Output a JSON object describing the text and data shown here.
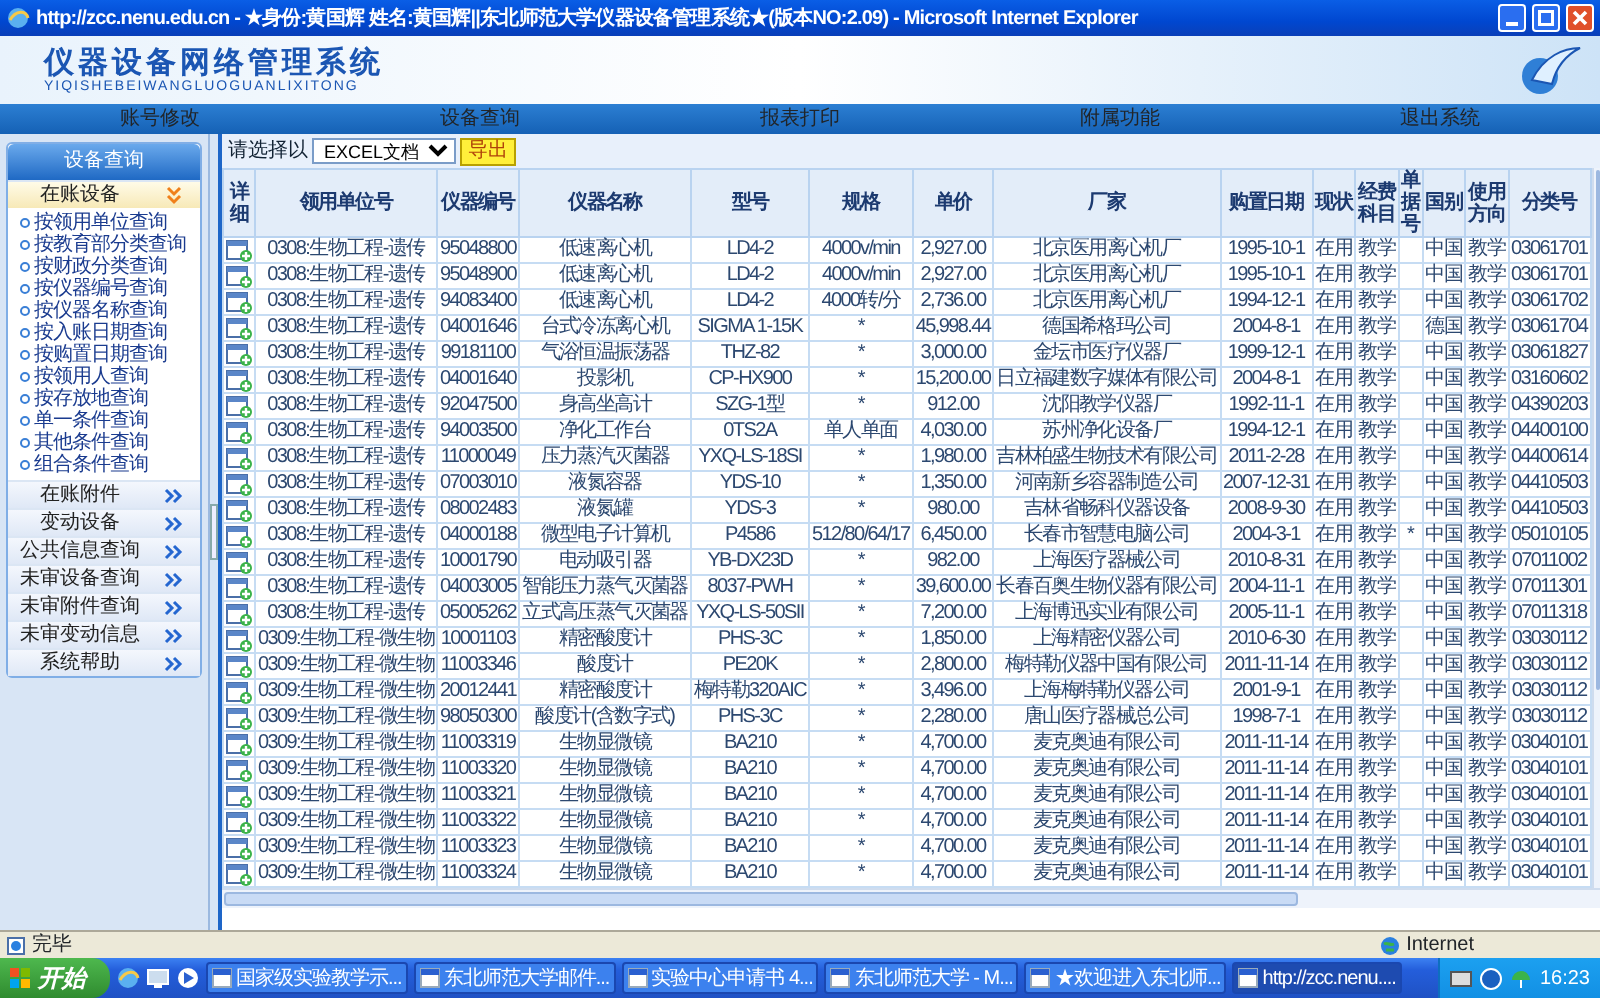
{
  "window": {
    "title": "http://zcc.nenu.edu.cn - ★身份:黄国辉 姓名:黄国辉||东北师范大学仪器设备管理系统★(版本NO:2.09) - Microsoft Internet Explorer"
  },
  "banner": {
    "title": "仪器设备网络管理系统",
    "subtitle": "YIQISHEBEIWANGLUOGUANLIXITONG"
  },
  "menu": [
    {
      "label": "账号修改"
    },
    {
      "label": "设备查询"
    },
    {
      "label": "报表打印"
    },
    {
      "label": "附属功能"
    },
    {
      "label": "退出系统"
    }
  ],
  "sidebar": {
    "title": "设备查询",
    "sections": [
      {
        "label": "在账设备",
        "expanded": true,
        "items": [
          "按领用单位查询",
          "按教育部分类查询",
          "按财政分类查询",
          "按仪器编号查询",
          "按仪器名称查询",
          "按入账日期查询",
          "按购置日期查询",
          "按领用人查询",
          "按存放地查询",
          "单一条件查询",
          "其他条件查询",
          "组合条件查询"
        ]
      },
      {
        "label": "在账附件",
        "expanded": false
      },
      {
        "label": "变动设备",
        "expanded": false
      },
      {
        "label": "公共信息查询",
        "expanded": false
      },
      {
        "label": "未审设备查询",
        "expanded": false
      },
      {
        "label": "未审附件查询",
        "expanded": false
      },
      {
        "label": "未审变动信息",
        "expanded": false
      },
      {
        "label": "系统帮助",
        "expanded": false
      }
    ]
  },
  "toolbar": {
    "label": "请选择以",
    "format": "EXCEL文档",
    "button": "导出"
  },
  "table": {
    "columns": [
      "详细",
      "领用单位号",
      "仪器编号",
      "仪器名称",
      "型号",
      "规格",
      "单价",
      "厂家",
      "购置日期",
      "现状",
      "经费科目",
      "单据号",
      "国别",
      "使用方向",
      "分类号"
    ],
    "rows": [
      {
        "unit": "0308:生物工程-遗传",
        "code": "95048800",
        "name": "低速离心机",
        "model": "LD4-2",
        "spec": "4000v/min",
        "price": "2,927.00",
        "maker": "北京医用离心机厂",
        "date": "1995-10-1",
        "status": "在用",
        "fund": "教学",
        "country": "中国",
        "usage": "教学",
        "class": "03061701"
      },
      {
        "unit": "0308:生物工程-遗传",
        "code": "95048900",
        "name": "低速离心机",
        "model": "LD4-2",
        "spec": "4000v/min",
        "price": "2,927.00",
        "maker": "北京医用离心机厂",
        "date": "1995-10-1",
        "status": "在用",
        "fund": "教学",
        "country": "中国",
        "usage": "教学",
        "class": "03061701"
      },
      {
        "unit": "0308:生物工程-遗传",
        "code": "94083400",
        "name": "低速离心机",
        "model": "LD4-2",
        "spec": "4000转/分",
        "price": "2,736.00",
        "maker": "北京医用离心机厂",
        "date": "1994-12-1",
        "status": "在用",
        "fund": "教学",
        "country": "中国",
        "usage": "教学",
        "class": "03061702"
      },
      {
        "unit": "0308:生物工程-遗传",
        "code": "04001646",
        "name": "台式冷冻离心机",
        "model": "SIGMA 1-15K",
        "spec": "*",
        "price": "45,998.44",
        "maker": "德国希格玛公司",
        "date": "2004-8-1",
        "status": "在用",
        "fund": "教学",
        "country": "德国",
        "usage": "教学",
        "class": "03061704"
      },
      {
        "unit": "0308:生物工程-遗传",
        "code": "99181100",
        "name": "气浴恒温振荡器",
        "model": "THZ-82",
        "spec": "*",
        "price": "3,000.00",
        "maker": "金坛市医疗仪器厂",
        "date": "1999-12-1",
        "status": "在用",
        "fund": "教学",
        "country": "中国",
        "usage": "教学",
        "class": "03061827"
      },
      {
        "unit": "0308:生物工程-遗传",
        "code": "04001640",
        "name": "投影机",
        "model": "CP-HX900",
        "spec": "*",
        "price": "15,200.00",
        "maker": "日立福建数字媒体有限公司",
        "date": "2004-8-1",
        "status": "在用",
        "fund": "教学",
        "country": "中国",
        "usage": "教学",
        "class": "03160602"
      },
      {
        "unit": "0308:生物工程-遗传",
        "code": "92047500",
        "name": "身高坐高计",
        "model": "SZG-1型",
        "spec": "*",
        "price": "912.00",
        "maker": "沈阳教学仪器厂",
        "date": "1992-11-1",
        "status": "在用",
        "fund": "教学",
        "country": "中国",
        "usage": "教学",
        "class": "04390203"
      },
      {
        "unit": "0308:生物工程-遗传",
        "code": "94003500",
        "name": "净化工作台",
        "model": "0TS2A",
        "spec": "单人单面",
        "price": "4,030.00",
        "maker": "苏州净化设备厂",
        "date": "1994-12-1",
        "status": "在用",
        "fund": "教学",
        "country": "中国",
        "usage": "教学",
        "class": "04400100"
      },
      {
        "unit": "0308:生物工程-遗传",
        "code": "11000049",
        "name": "压力蒸汽灭菌器",
        "model": "YXQ-LS-18SI",
        "spec": "*",
        "price": "1,980.00",
        "maker": "吉林柏盛生物技术有限公司",
        "date": "2011-2-28",
        "status": "在用",
        "fund": "教学",
        "country": "中国",
        "usage": "教学",
        "class": "04400614"
      },
      {
        "unit": "0308:生物工程-遗传",
        "code": "07003010",
        "name": "液氮容器",
        "model": "YDS-10",
        "spec": "*",
        "price": "1,350.00",
        "maker": "河南新乡容器制造公司",
        "date": "2007-12-31",
        "status": "在用",
        "fund": "教学",
        "country": "中国",
        "usage": "教学",
        "class": "04410503"
      },
      {
        "unit": "0308:生物工程-遗传",
        "code": "08002483",
        "name": "液氮罐",
        "model": "YDS-3",
        "spec": "*",
        "price": "980.00",
        "maker": "吉林省畅科仪器设备",
        "date": "2008-9-30",
        "status": "在用",
        "fund": "教学",
        "country": "中国",
        "usage": "教学",
        "class": "04410503"
      },
      {
        "unit": "0308:生物工程-遗传",
        "code": "04000188",
        "name": "微型电子计算机",
        "model": "P4586",
        "spec": "512/80/64/17",
        "price": "6,450.00",
        "maker": "长春市智慧电脑公司",
        "date": "2004-3-1",
        "status": "在用",
        "fund": "教学",
        "doc": "*",
        "country": "中国",
        "usage": "教学",
        "class": "05010105"
      },
      {
        "unit": "0308:生物工程-遗传",
        "code": "10001790",
        "name": "电动吸引器",
        "model": "YB-DX23D",
        "spec": "*",
        "price": "982.00",
        "maker": "上海医疗器械公司",
        "date": "2010-8-31",
        "status": "在用",
        "fund": "教学",
        "country": "中国",
        "usage": "教学",
        "class": "07011002"
      },
      {
        "unit": "0308:生物工程-遗传",
        "code": "04003005",
        "name": "智能压力蒸气灭菌器",
        "model": "8037-PWH",
        "spec": "*",
        "price": "39,600.00",
        "maker": "长春百奥生物仪器有限公司",
        "date": "2004-11-1",
        "status": "在用",
        "fund": "教学",
        "country": "中国",
        "usage": "教学",
        "class": "07011301"
      },
      {
        "unit": "0308:生物工程-遗传",
        "code": "05005262",
        "name": "立式高压蒸气灭菌器",
        "model": "YXQ-LS-50SII",
        "spec": "*",
        "price": "7,200.00",
        "maker": "上海博迅实业有限公司",
        "date": "2005-11-1",
        "status": "在用",
        "fund": "教学",
        "country": "中国",
        "usage": "教学",
        "class": "07011318"
      },
      {
        "unit": "0309:生物工程-微生物",
        "code": "10001103",
        "name": "精密酸度计",
        "model": "PHS-3C",
        "spec": "*",
        "price": "1,850.00",
        "maker": "上海精密仪器公司",
        "date": "2010-6-30",
        "status": "在用",
        "fund": "教学",
        "country": "中国",
        "usage": "教学",
        "class": "03030112"
      },
      {
        "unit": "0309:生物工程-微生物",
        "code": "11003346",
        "name": "酸度计",
        "model": "PE20K",
        "spec": "*",
        "price": "2,800.00",
        "maker": "梅特勒仪器中国有限公司",
        "date": "2011-11-14",
        "status": "在用",
        "fund": "教学",
        "country": "中国",
        "usage": "教学",
        "class": "03030112"
      },
      {
        "unit": "0309:生物工程-微生物",
        "code": "20012441",
        "name": "精密酸度计",
        "model": "梅特勒320AIC",
        "spec": "*",
        "price": "3,496.00",
        "maker": "上海梅特勒仪器公司",
        "date": "2001-9-1",
        "status": "在用",
        "fund": "教学",
        "country": "中国",
        "usage": "教学",
        "class": "03030112"
      },
      {
        "unit": "0309:生物工程-微生物",
        "code": "98050300",
        "name": "酸度计(含数字式)",
        "model": "PHS-3C",
        "spec": "*",
        "price": "2,280.00",
        "maker": "唐山医疗器械总公司",
        "date": "1998-7-1",
        "status": "在用",
        "fund": "教学",
        "country": "中国",
        "usage": "教学",
        "class": "03030112"
      },
      {
        "unit": "0309:生物工程-微生物",
        "code": "11003319",
        "name": "生物显微镜",
        "model": "BA210",
        "spec": "*",
        "price": "4,700.00",
        "maker": "麦克奥迪有限公司",
        "date": "2011-11-14",
        "status": "在用",
        "fund": "教学",
        "country": "中国",
        "usage": "教学",
        "class": "03040101"
      },
      {
        "unit": "0309:生物工程-微生物",
        "code": "11003320",
        "name": "生物显微镜",
        "model": "BA210",
        "spec": "*",
        "price": "4,700.00",
        "maker": "麦克奥迪有限公司",
        "date": "2011-11-14",
        "status": "在用",
        "fund": "教学",
        "country": "中国",
        "usage": "教学",
        "class": "03040101"
      },
      {
        "unit": "0309:生物工程-微生物",
        "code": "11003321",
        "name": "生物显微镜",
        "model": "BA210",
        "spec": "*",
        "price": "4,700.00",
        "maker": "麦克奥迪有限公司",
        "date": "2011-11-14",
        "status": "在用",
        "fund": "教学",
        "country": "中国",
        "usage": "教学",
        "class": "03040101"
      },
      {
        "unit": "0309:生物工程-微生物",
        "code": "11003322",
        "name": "生物显微镜",
        "model": "BA210",
        "spec": "*",
        "price": "4,700.00",
        "maker": "麦克奥迪有限公司",
        "date": "2011-11-14",
        "status": "在用",
        "fund": "教学",
        "country": "中国",
        "usage": "教学",
        "class": "03040101"
      },
      {
        "unit": "0309:生物工程-微生物",
        "code": "11003323",
        "name": "生物显微镜",
        "model": "BA210",
        "spec": "*",
        "price": "4,700.00",
        "maker": "麦克奥迪有限公司",
        "date": "2011-11-14",
        "status": "在用",
        "fund": "教学",
        "country": "中国",
        "usage": "教学",
        "class": "03040101"
      },
      {
        "unit": "0309:生物工程-微生物",
        "code": "11003324",
        "name": "生物显微镜",
        "model": "BA210",
        "spec": "*",
        "price": "4,700.00",
        "maker": "麦克奥迪有限公司",
        "date": "2011-11-14",
        "status": "在用",
        "fund": "教学",
        "country": "中国",
        "usage": "教学",
        "class": "03040101"
      }
    ]
  },
  "status_bar": {
    "text": "完毕",
    "zone": "Internet"
  },
  "taskbar": {
    "start": "开始",
    "tasks": [
      {
        "label": "国家级实验教学示...",
        "selected": false
      },
      {
        "label": "东北师范大学邮件...",
        "selected": false
      },
      {
        "label": "实验中心申请书 4...",
        "selected": false
      },
      {
        "label": "东北师范大学 - M...",
        "selected": false
      },
      {
        "label": "★欢迎进入东北师...",
        "selected": false
      },
      {
        "label": "http://zcc.nenu....",
        "selected": true
      }
    ],
    "clock": "16:23"
  }
}
